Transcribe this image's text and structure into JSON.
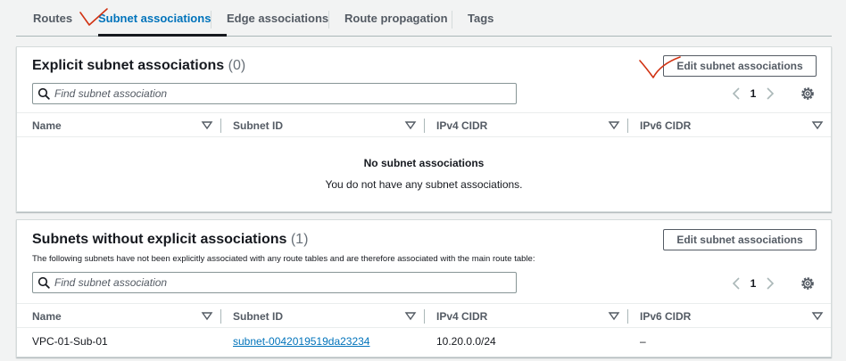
{
  "tabs": [
    {
      "label": "Routes"
    },
    {
      "label": "Subnet associations"
    },
    {
      "label": "Edge associations"
    },
    {
      "label": "Route propagation"
    },
    {
      "label": "Tags"
    }
  ],
  "explicit": {
    "title": "Explicit subnet associations",
    "count": "(0)",
    "edit_button": "Edit subnet associations",
    "search_placeholder": "Find subnet association",
    "page": "1",
    "columns": [
      "Name",
      "Subnet ID",
      "IPv4 CIDR",
      "IPv6 CIDR"
    ],
    "empty_title": "No subnet associations",
    "empty_message": "You do not have any subnet associations."
  },
  "implicit": {
    "title": "Subnets without explicit associations",
    "count": "(1)",
    "description": "The following subnets have not been explicitly associated with any route tables and are therefore associated with the main route table:",
    "edit_button": "Edit subnet associations",
    "search_placeholder": "Find subnet association",
    "page": "1",
    "columns": [
      "Name",
      "Subnet ID",
      "IPv4 CIDR",
      "IPv6 CIDR"
    ],
    "rows": [
      {
        "name": "VPC-01-Sub-01",
        "subnet_id": "subnet-0042019519da23234",
        "ipv4": "10.20.0.0/24",
        "ipv6": "–"
      }
    ]
  },
  "colors": {
    "link": "#0073bb",
    "text": "#16191f",
    "muted": "#545b64",
    "annotation": "#d13212",
    "background": "#f2f3f3"
  },
  "icons": [
    "search-icon",
    "chevron-left-icon",
    "chevron-right-icon",
    "gear-icon",
    "sort-caret-icon",
    "checkmark-annotation"
  ]
}
